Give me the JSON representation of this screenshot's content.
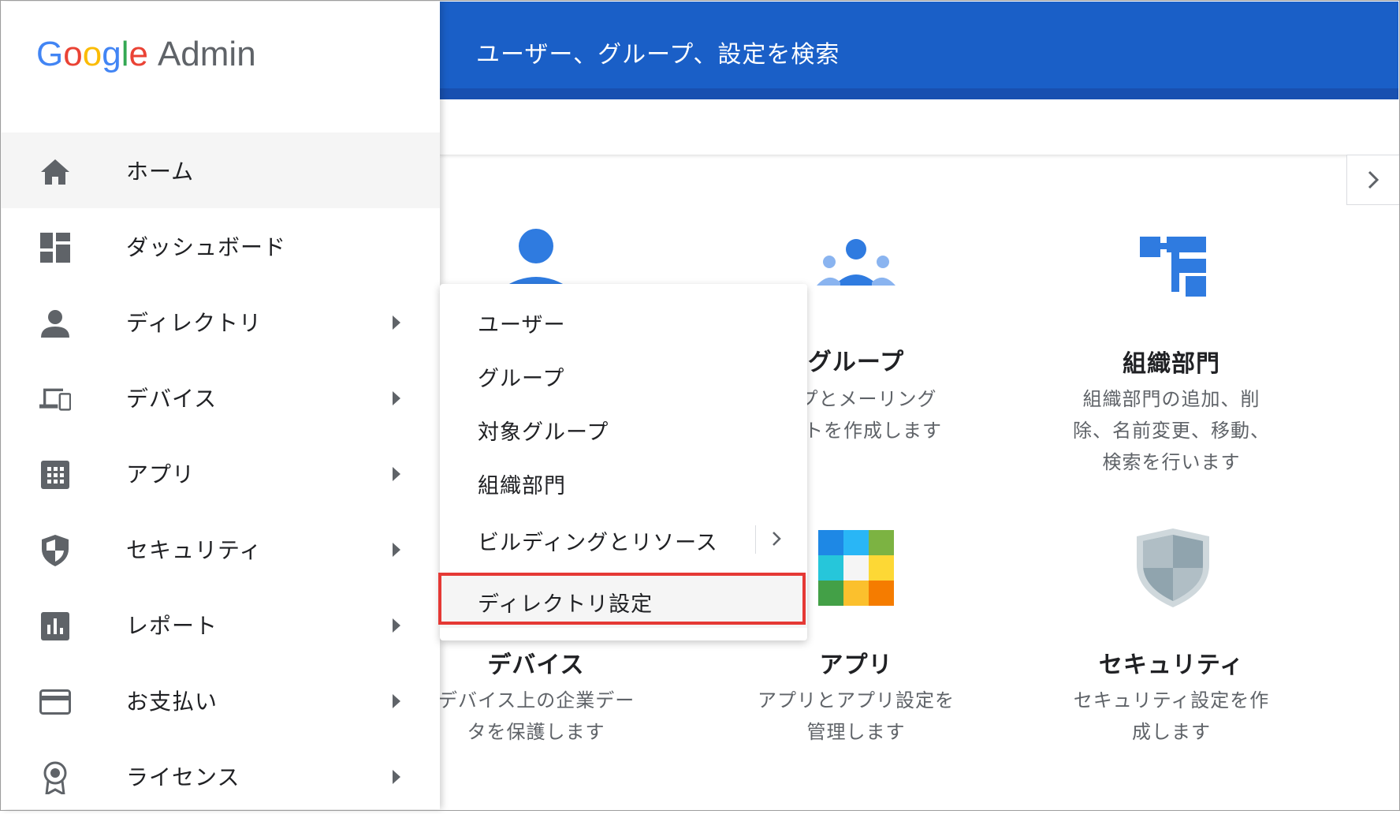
{
  "logo": {
    "google": "Google",
    "admin": "Admin"
  },
  "search": {
    "placeholder": "ユーザー、グループ、設定を検索"
  },
  "sidebar": {
    "items": [
      {
        "label": "ホーム",
        "icon": "home-icon",
        "active": true
      },
      {
        "label": "ダッシュボード",
        "icon": "dashboard-icon"
      },
      {
        "label": "ディレクトリ",
        "icon": "person-icon",
        "arrow": true
      },
      {
        "label": "デバイス",
        "icon": "devices-icon",
        "arrow": true
      },
      {
        "label": "アプリ",
        "icon": "apps-grid-icon",
        "arrow": true
      },
      {
        "label": "セキュリティ",
        "icon": "shield-icon",
        "arrow": true
      },
      {
        "label": "レポート",
        "icon": "bar-chart-icon",
        "arrow": true
      },
      {
        "label": "お支払い",
        "icon": "credit-card-icon",
        "arrow": true
      },
      {
        "label": "ライセンス",
        "icon": "license-icon",
        "arrow": true
      }
    ]
  },
  "dropdown": {
    "items": [
      "ユーザー",
      "グループ",
      "対象グループ",
      "組織部門",
      "ビルディングとリソース",
      "ディレクトリ設定"
    ]
  },
  "tiles": {
    "group": {
      "title": "グループ",
      "desc1": "ープとメーリング",
      "desc2": "トを作成します"
    },
    "org": {
      "title": "組織部門",
      "desc1": "組織部門の追加、削",
      "desc2": "除、名前変更、移動、",
      "desc3": "検索を行います"
    },
    "devices": {
      "title": "デバイス",
      "desc1": "デバイス上の企業デー",
      "desc2": "タを保護します"
    },
    "apps": {
      "title": "アプリ",
      "desc1": "アプリとアプリ設定を",
      "desc2": "管理します"
    },
    "security": {
      "title": "セキュリティ",
      "desc1": "セキュリティ設定を作",
      "desc2": "成します"
    }
  },
  "colors": {
    "topbar": "#1a5fc7",
    "accent": "#4285f4",
    "highlight": "#e53935"
  }
}
